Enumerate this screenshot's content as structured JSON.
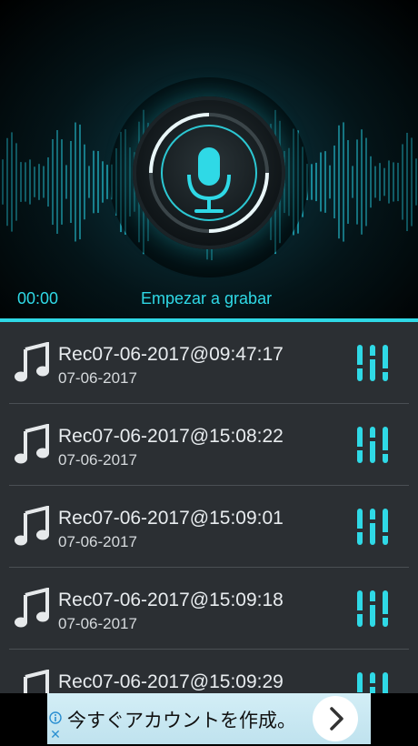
{
  "recorder": {
    "timer": "00:00",
    "start_label": "Empezar a grabar"
  },
  "recordings": [
    {
      "title": "Rec07-06-2017@09:47:17",
      "date": "07-06-2017"
    },
    {
      "title": "Rec07-06-2017@15:08:22",
      "date": "07-06-2017"
    },
    {
      "title": "Rec07-06-2017@15:09:01",
      "date": "07-06-2017"
    },
    {
      "title": "Rec07-06-2017@15:09:18",
      "date": "07-06-2017"
    },
    {
      "title": "Rec07-06-2017@15:09:29",
      "date": ""
    }
  ],
  "ad": {
    "text": "今すぐアカウントを作成。",
    "close": "✕"
  },
  "colors": {
    "accent": "#2fd9e6",
    "list_background": "#2b2f33",
    "divider": "#4a4f54"
  },
  "icons": [
    "microphone-icon",
    "music-note-icon",
    "equalizer-icon",
    "chevron-right-icon",
    "info-icon",
    "close-icon"
  ]
}
